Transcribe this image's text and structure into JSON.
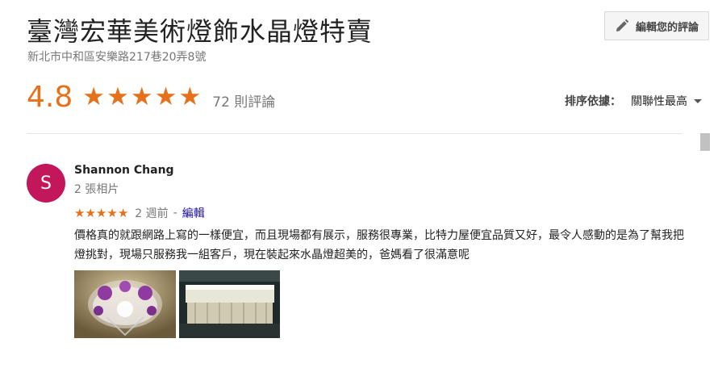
{
  "place": {
    "title": "臺灣宏華美術燈飾水晶燈特賣",
    "address": "新北市中和區安樂路217巷20弄8號"
  },
  "toolbar": {
    "edit_review_label": "編輯您的評論",
    "edit_review_icon": "pencil-icon"
  },
  "rating": {
    "score": "4.8",
    "stars_filled": 5,
    "star_color": "#e7711b",
    "review_count": "72 則評論"
  },
  "sort": {
    "label": "排序依據：",
    "value": "關聯性最高"
  },
  "reviews": [
    {
      "avatar_letter": "S",
      "avatar_color": "#c2185b",
      "name": "Shannon Chang",
      "photos_count": "2 張相片",
      "stars": 5,
      "date": "2 週前",
      "separator": "-",
      "edit_label": "編輯",
      "text": "價格真的就跟網路上寫的一樣便宜，而且現場都有展示，服務很專業，比特力屋便宜品質又好，最令人感動的是為了幫我把燈挑對，現場只服務我一組客戶，現在裝起來水晶燈超美的，爸媽看了很滿意呢",
      "photos": [
        "crystal-chandelier-purple-photo",
        "crystal-chandelier-rectangular-photo"
      ]
    }
  ]
}
